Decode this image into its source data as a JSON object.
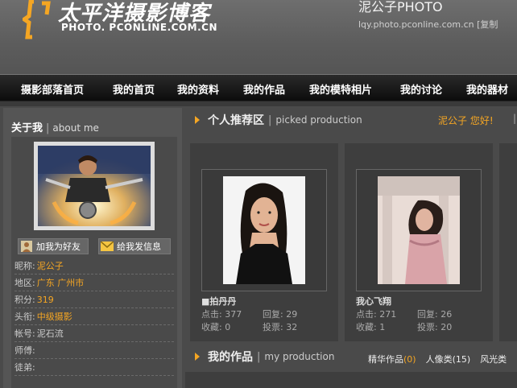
{
  "header": {
    "logo_cn": "太平洋摄影博客",
    "logo_en": "PHOTO. PCONLINE.COM.CN",
    "blog_title": "泥公子PHOTO",
    "blog_url": "lqy.photo.pconline.com.cn [复制"
  },
  "nav": {
    "items": [
      {
        "label": "摄影部落首页"
      },
      {
        "label": "我的首页"
      },
      {
        "label": "我的资料"
      },
      {
        "label": "我的作品"
      },
      {
        "label": "我的模特相片"
      },
      {
        "label": "我的讨论"
      },
      {
        "label": "我的器材"
      }
    ]
  },
  "about": {
    "title": "关于我",
    "sep": "|",
    "title_en": "about me",
    "add_friend": "加我为好友",
    "send_message": "给我发信息",
    "fields": [
      {
        "key": "昵称:",
        "value": "泥公子",
        "highlight": true
      },
      {
        "key": "地区:",
        "value": "广东 广州市",
        "highlight": true
      },
      {
        "key": "积分:",
        "value": "319",
        "highlight": true
      },
      {
        "key": "头衔:",
        "value": "中级摄影",
        "highlight": true
      },
      {
        "key": "帐号:",
        "value": "泥石流",
        "highlight": false
      },
      {
        "key": "师傅:",
        "value": "",
        "highlight": false
      },
      {
        "key": "徒弟:",
        "value": "",
        "highlight": false
      }
    ]
  },
  "picked": {
    "title": "个人推荐区",
    "sep": "|",
    "title_en": "picked production",
    "greeting": "泥公子  您好!",
    "cards": [
      {
        "name": "■拍丹丹",
        "clicks_label": "点击:",
        "clicks": "377",
        "replies_label": "回复:",
        "replies": "29",
        "favs_label": "收藏:",
        "favs": "0",
        "votes_label": "投票:",
        "votes": "32"
      },
      {
        "name": "我心飞翔",
        "clicks_label": "点击:",
        "clicks": "271",
        "replies_label": "回复:",
        "replies": "26",
        "favs_label": "收藏:",
        "favs": "1",
        "votes_label": "投票:",
        "votes": "20"
      }
    ]
  },
  "production": {
    "title": "我的作品",
    "sep": "|",
    "title_en": "my production",
    "tabs": [
      {
        "label": "精华作品",
        "count": "(0)"
      },
      {
        "label": "人像类",
        "count": "(15)"
      },
      {
        "label": "风光类",
        "count": ""
      }
    ]
  },
  "colors": {
    "accent": "#f5a623",
    "background": "#4a4a4a"
  }
}
